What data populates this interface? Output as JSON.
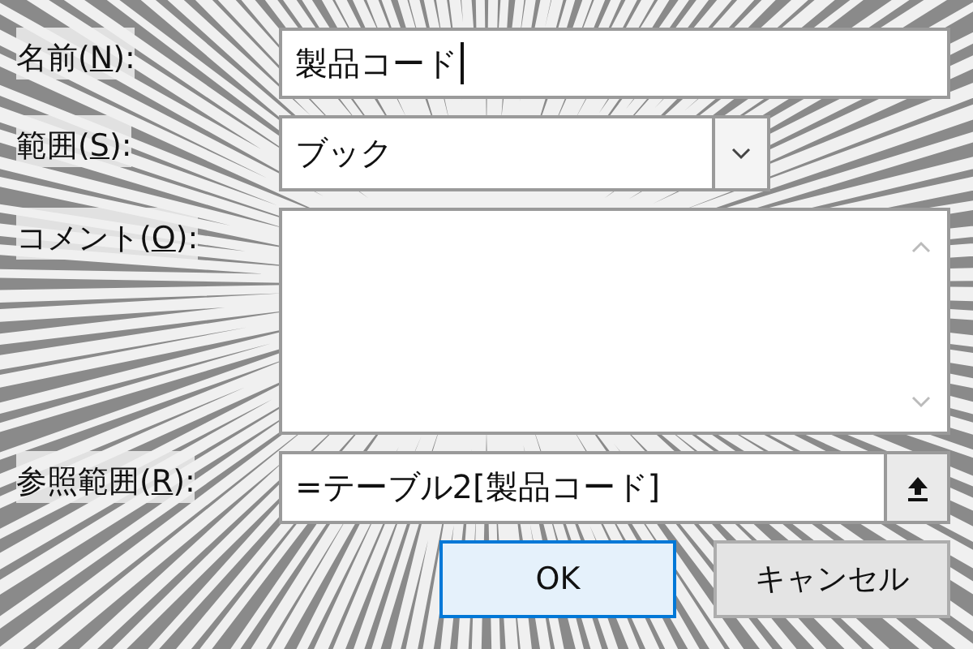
{
  "name_field": {
    "label": {
      "before": "名前(",
      "key": "N",
      "after": "):"
    },
    "value": "製品コード"
  },
  "scope_field": {
    "label": {
      "before": "範囲(",
      "key": "S",
      "after": "):"
    },
    "value": "ブック"
  },
  "comment_field": {
    "label": {
      "before": "コメント(",
      "key": "O",
      "after": "):"
    }
  },
  "reference_field": {
    "label": {
      "before": "参照範囲(",
      "key": "R",
      "after": "):"
    },
    "value": "=テーブル2[製品コード]"
  },
  "buttons": [
    {
      "label": "OK",
      "kind": "default"
    },
    {
      "label": "キャンセル",
      "kind": "normal"
    }
  ]
}
